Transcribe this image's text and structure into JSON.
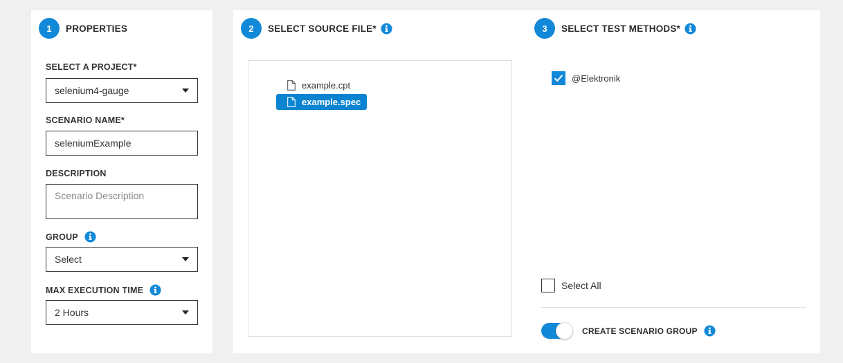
{
  "colors": {
    "accent": "#1288d8",
    "selected_file_bg": "#0a84d0",
    "page_bg": "#f0f0f0"
  },
  "properties": {
    "step": "1",
    "title": "PROPERTIES",
    "project": {
      "label": "SELECT A PROJECT*",
      "value": "selenium4-gauge"
    },
    "scenario_name": {
      "label": "SCENARIO NAME*",
      "value": "seleniumExample"
    },
    "description": {
      "label": "DESCRIPTION",
      "placeholder": "Scenario Description",
      "value": ""
    },
    "group": {
      "label": "GROUP",
      "value": "Select",
      "icon": "info-icon"
    },
    "max_execution_time": {
      "label": "MAX EXECUTION TIME",
      "value": "2 Hours",
      "icon": "info-icon"
    }
  },
  "source_file": {
    "step": "2",
    "title": "SELECT SOURCE FILE*",
    "icon": "info-icon",
    "files": [
      {
        "name": "example.cpt",
        "selected": false,
        "icon": "file-icon"
      },
      {
        "name": "example.spec",
        "selected": true,
        "icon": "file-icon"
      }
    ]
  },
  "test_methods": {
    "step": "3",
    "title": "SELECT TEST METHODS*",
    "icon": "info-icon",
    "methods": [
      {
        "name": "@Elektronik",
        "checked": true
      }
    ],
    "select_all": {
      "label": "Select All",
      "checked": false
    },
    "create_group": {
      "label": "CREATE SCENARIO GROUP",
      "enabled": true,
      "icon": "info-icon"
    }
  }
}
